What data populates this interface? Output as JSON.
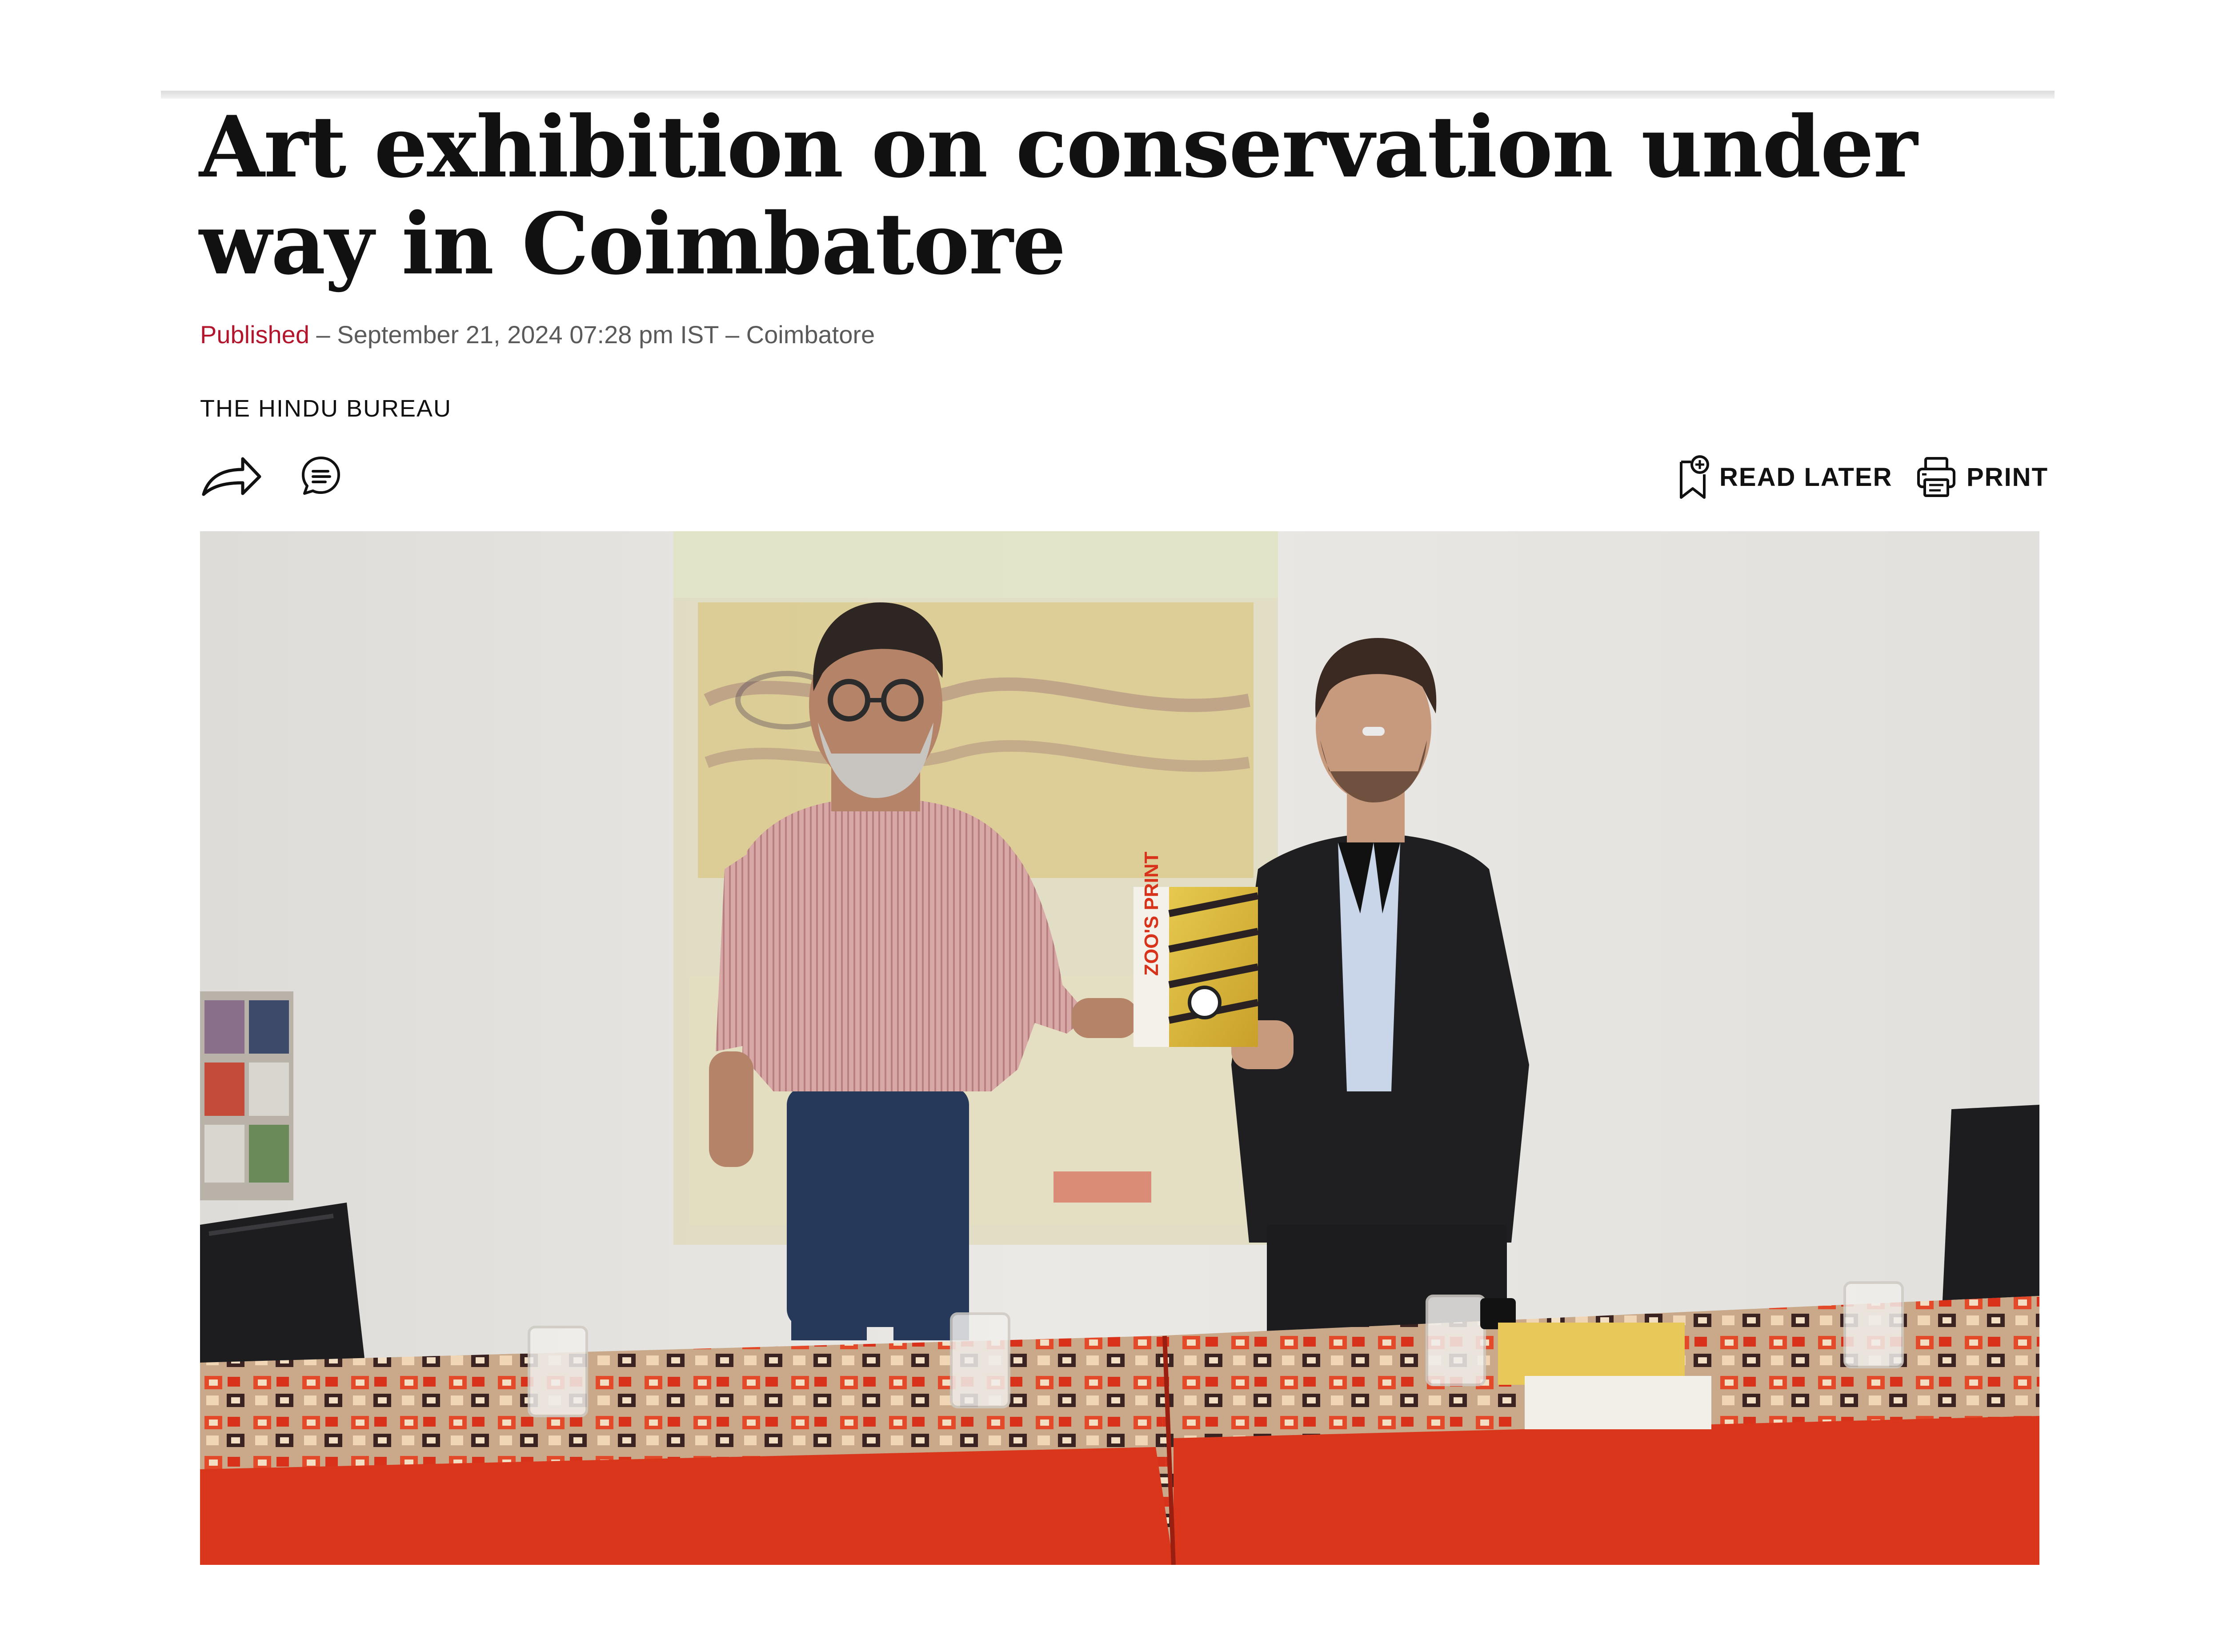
{
  "article": {
    "headline": "Art exhibition on conservation under way in Coimbatore",
    "published_label": "Published",
    "published_rest": " – September 21, 2024 07:28 pm IST – Coimbatore",
    "byline": "THE HINDU BUREAU"
  },
  "toolbar": {
    "share_icon": "share-arrow-icon",
    "comment_icon": "comment-bubble-icon",
    "read_later_label": "READ LATER",
    "read_later_icon": "bookmark-plus-icon",
    "print_label": "PRINT",
    "print_icon": "printer-icon"
  },
  "image": {
    "description_icon": "photo",
    "book_title": "ZOO'S PRINT"
  },
  "colors": {
    "accent": "#b3162c",
    "text": "#111111",
    "meta_text": "#5a5a5a",
    "tablecloth": "#d9361c"
  }
}
